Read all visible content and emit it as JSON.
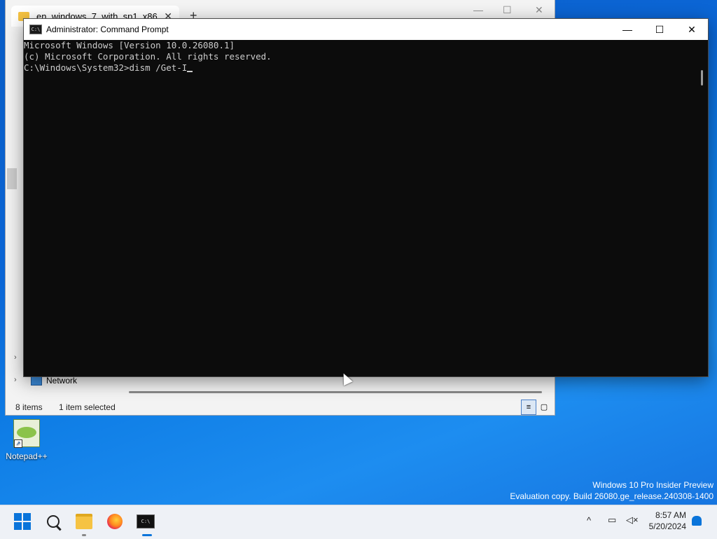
{
  "explorer": {
    "tab_title": "en_windows_7_with_sp1_x86",
    "tab_close": "✕",
    "new_tab": "+",
    "minimize": "—",
    "maximize": "☐",
    "close": "✕",
    "nav_network": "Network",
    "status_items": "8 items",
    "status_selected": "1 item selected"
  },
  "cmd": {
    "title": "Administrator: Command Prompt",
    "icon_text": "C:\\",
    "minimize": "—",
    "maximize": "☐",
    "close": "✕",
    "lines": [
      "Microsoft Windows [Version 10.0.26080.1]",
      "(c) Microsoft Corporation. All rights reserved.",
      "",
      "C:\\Windows\\System32>dism /Get-I"
    ]
  },
  "desktop": {
    "icons": [
      {
        "label": "Notepad++"
      }
    ]
  },
  "watermark": {
    "line1": "Windows 10 Pro Insider Preview",
    "line2": "Evaluation copy. Build 26080.ge_release.240308-1400"
  },
  "taskbar": {
    "time": "8:57 AM",
    "date": "5/20/2024",
    "tray_chevron": "^",
    "icons": [
      "start-icon",
      "search-icon",
      "file-explorer-icon",
      "firefox-icon",
      "command-prompt-icon"
    ]
  }
}
